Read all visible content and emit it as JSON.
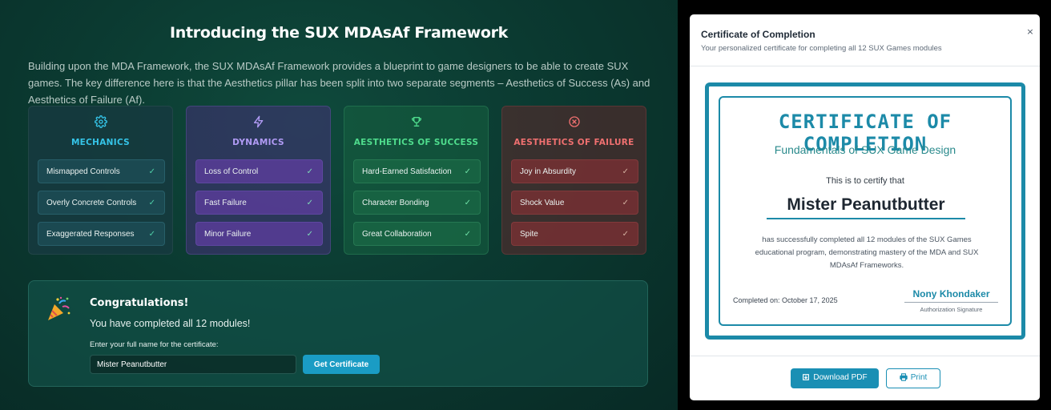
{
  "page": {
    "title": "Introducing the SUX MDAsAf Framework",
    "description": "Building upon the MDA Framework, the SUX MDAsAf Framework provides a blueprint to game designers to be able to create SUX games. The key difference here is that the Aesthetics pillar has been split into two separate segments – Aesthetics of Success (As) and Aesthetics of Failure (Af)."
  },
  "columns": [
    {
      "title": "MECHANICS",
      "icon": "gear-icon",
      "items": [
        "Mismapped Controls",
        "Overly Concrete Controls",
        "Exaggerated Responses"
      ]
    },
    {
      "title": "DYNAMICS",
      "icon": "lightning-icon",
      "items": [
        "Loss of Control",
        "Fast Failure",
        "Minor Failure"
      ]
    },
    {
      "title": "AESTHETICS OF SUCCESS",
      "icon": "trophy-icon",
      "items": [
        "Hard-Earned Satisfaction",
        "Character Bonding",
        "Great Collaboration"
      ]
    },
    {
      "title": "AESTHETICS OF FAILURE",
      "icon": "x-circle-icon",
      "items": [
        "Joy in Absurdity",
        "Shock Value",
        "Spite"
      ]
    }
  ],
  "check_glyph": "✓",
  "congrats": {
    "title": "Congratulations!",
    "subtitle": "You have completed all 12 modules!",
    "label": "Enter your full name for the certificate:",
    "name_value": "Mister Peanutbutter",
    "button": "Get Certificate"
  },
  "modal": {
    "title": "Certificate of Completion",
    "subtitle": "Your personalized certificate for completing all 12 SUX Games modules",
    "close": "×",
    "certificate": {
      "heading": "CERTIFICATE OF COMPLETION",
      "course": "Fundamentals of SUX Game Design",
      "certify": "This is to certify that",
      "name": "Mister Peanutbutter",
      "description": "has successfully completed all 12 modules of the SUX Games educational program, demonstrating mastery of the MDA and SUX MDAsAf Frameworks.",
      "date": "Completed on: October 17, 2025",
      "signer": "Nony Khondaker",
      "signature_label": "Authorization Signature"
    },
    "download_button": "Download PDF",
    "print_button": "Print"
  },
  "colors": {
    "accent": "#1c8aa8",
    "mechanics": "#35c4e8",
    "dynamics": "#b19bf5",
    "success": "#4fdc8d",
    "failure": "#f07070"
  }
}
